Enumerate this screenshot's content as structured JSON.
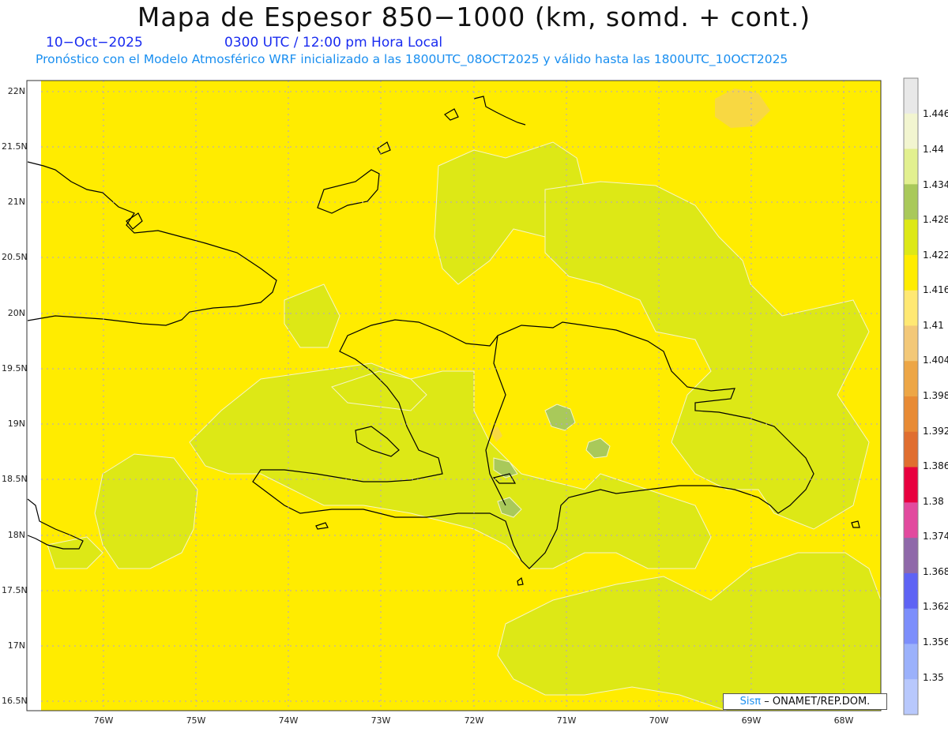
{
  "header": {
    "title": "Mapa de Espesor 850−1000 (km, somd. + cont.)",
    "date": "10−Oct−2025",
    "time": "0300 UTC / 12:00 pm Hora Local",
    "forecast_line": "Pronóstico con el Modelo Atmosférico WRF inicializado a las 1800UTC_08OCT2025 y válido hasta las  1800UTC_10OCT2025"
  },
  "axes": {
    "lat_labels": [
      "22N",
      "21.5N",
      "21N",
      "20.5N",
      "20N",
      "19.5N",
      "19N",
      "18.5N",
      "18N",
      "17.5N",
      "17N",
      "16.5N"
    ],
    "lon_labels": [
      "76W",
      "75W",
      "74W",
      "73W",
      "72W",
      "71W",
      "70W",
      "69W",
      "68W"
    ]
  },
  "colorbar": {
    "labels": [
      "1.446",
      "1.44",
      "1.434",
      "1.428",
      "1.422",
      "1.416",
      "1.41",
      "1.404",
      "1.398",
      "1.392",
      "1.386",
      "1.38",
      "1.374",
      "1.368",
      "1.362",
      "1.356",
      "1.35"
    ],
    "colors": [
      "#e8e8e8",
      "#f2f5d0",
      "#e2f08f",
      "#a9c95a",
      "#dde816",
      "#ffec00",
      "#ffe873",
      "#f3c878",
      "#eda646",
      "#e88b35",
      "#e06e30",
      "#e8003f",
      "#e24a9e",
      "#8f69a9",
      "#5e63f4",
      "#7c8efb",
      "#9bb1fb",
      "#b8c8fc"
    ]
  },
  "map": {
    "background_color": "#ffec00",
    "contour_fill_color": "#dde816",
    "highlight_color": "#a9c95a",
    "light_color": "#f3c878"
  },
  "credit": {
    "sis": "Sisπ",
    "text": "– ONAMET/REP.DOM."
  }
}
